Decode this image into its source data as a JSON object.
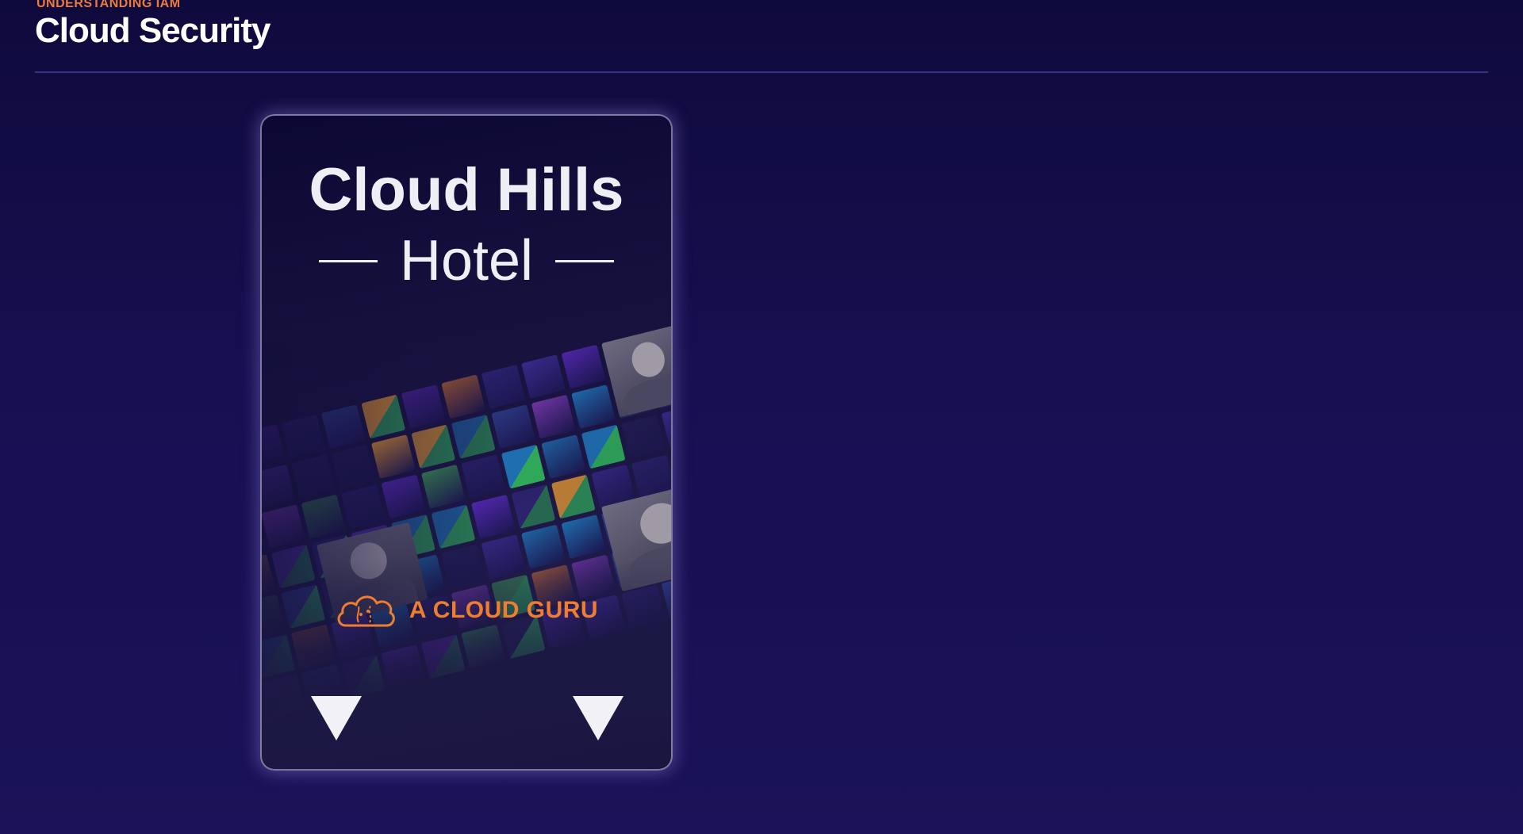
{
  "header": {
    "kicker": "UNDERSTANDING IAM",
    "title": "Cloud Security"
  },
  "card": {
    "title": "Cloud Hills",
    "subtitle": "Hotel",
    "brand": {
      "text": "A CLOUD GURU",
      "logo_icon": "cloud-icon",
      "color": "#ee7d2f"
    },
    "arrows": [
      "down-triangle-icon",
      "down-triangle-icon"
    ]
  },
  "colors": {
    "background": "#170f50",
    "accent": "#ef7b3a",
    "divider": "#3a3180"
  }
}
